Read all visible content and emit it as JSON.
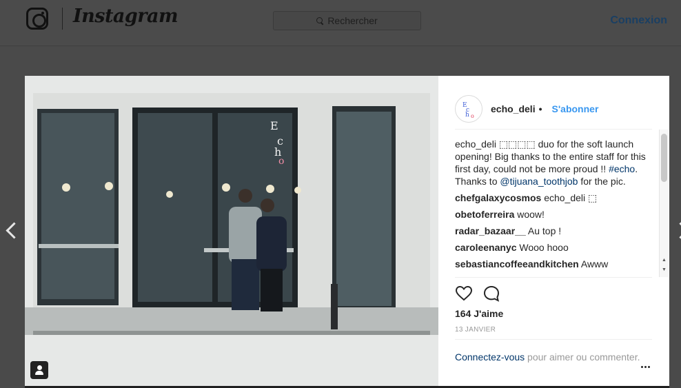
{
  "header": {
    "wordmark": "Instagram",
    "search_placeholder": "Rechercher",
    "login_label": "Connexion"
  },
  "post": {
    "username": "echo_deli",
    "header_separator": "•",
    "follow_label": "S'abonner",
    "caption": {
      "username": "echo_deli",
      "text_before": "⬚⬚⬚⬚ duo for the soft launch opening! Big thanks to the entire staff for this first day, could not be more proud !! ",
      "hashtag": "#echo",
      "text_middle": ". Thanks to ",
      "mention": "@tijuana_toothjob",
      "text_after": " for the pic."
    },
    "comments": [
      {
        "user": "chefgalaxycosmos",
        "text": "echo_deli ⬚"
      },
      {
        "user": "obetoferreira",
        "text": "woow!"
      },
      {
        "user": "radar_bazaar__",
        "text": "Au top !"
      },
      {
        "user": "caroleenanyc",
        "text": "Wooo hooo"
      },
      {
        "user": "sebastiancoffeeandkitchen",
        "text": "Awww"
      }
    ],
    "likes": "164 J'aime",
    "date": "13 JANVIER",
    "login_prompt": {
      "link": "Connectez-vous",
      "text": " pour aimer ou commenter."
    }
  },
  "icons": {
    "logo": "instagram-camera-icon",
    "search": "search-icon",
    "like": "heart-icon",
    "comment": "comment-icon",
    "more": "more-dots-icon",
    "tag": "user-tag-icon",
    "prev": "chevron-left-icon",
    "next": "chevron-right-icon"
  },
  "colors": {
    "link_blue": "#3897f0",
    "dark_link": "#003569",
    "overlay": "#4a4a4a"
  }
}
